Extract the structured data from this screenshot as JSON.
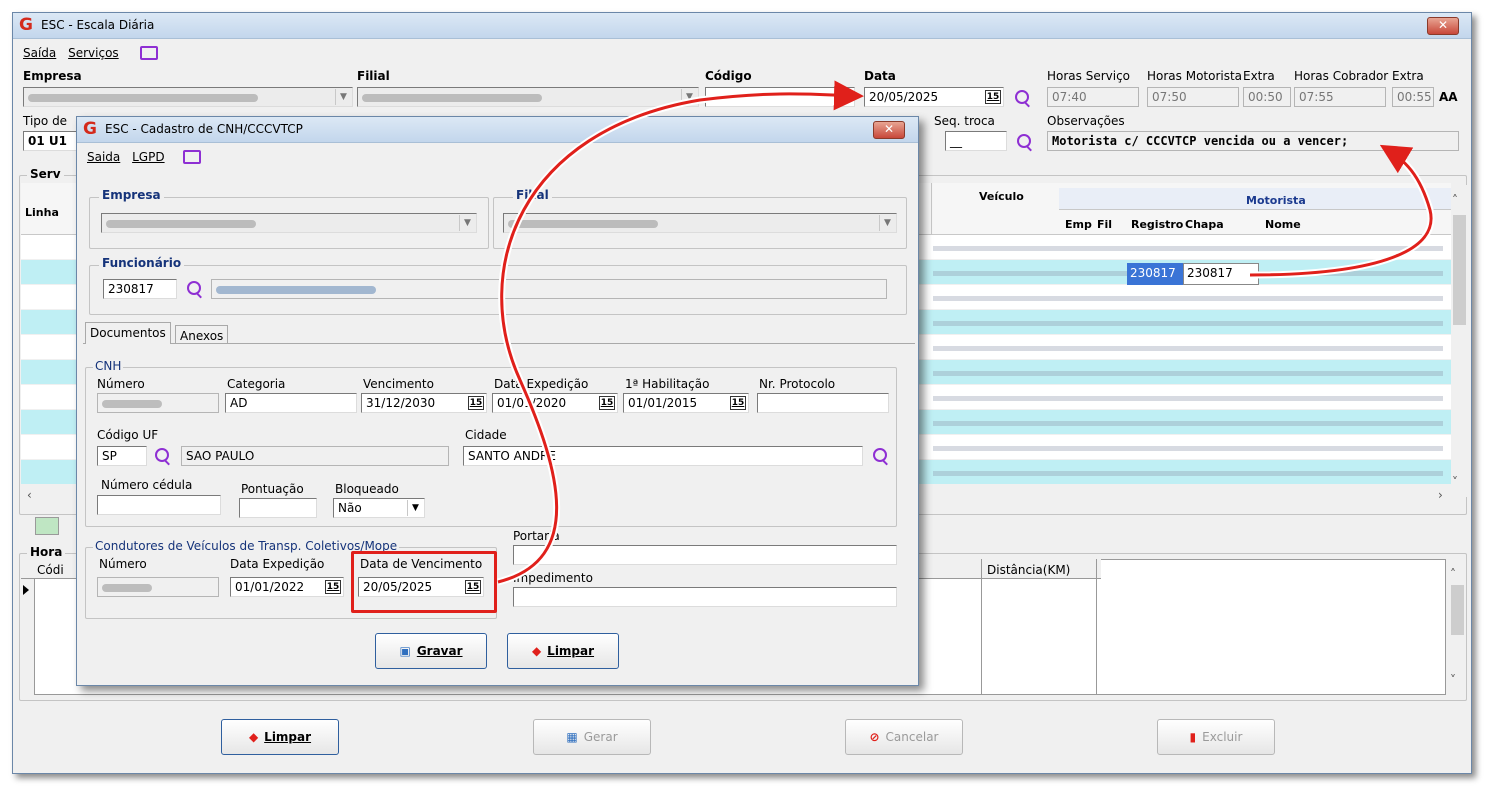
{
  "main": {
    "title": "ESC - Escala Diária",
    "close": "✕",
    "menu": {
      "saida": "Saída",
      "servicos": "Serviços"
    },
    "labels": {
      "empresa": "Empresa",
      "filial": "Filial",
      "codigo": "Código",
      "data": "Data",
      "horas_servico": "Horas Serviço",
      "horas_motorista": "Horas Motorista",
      "extra1": "Extra",
      "horas_cobrador": "Horas Cobrador",
      "extra2": "Extra",
      "tipo": "Tipo de",
      "seq_troca": "Seq. troca",
      "observacoes": "Observações",
      "tipo_value": "01 U1",
      "serv": "Serv",
      "hora": "Hora",
      "linha": "Linha",
      "codi": "Códi",
      "veiculo": "Veículo",
      "motorista": "Motorista",
      "emp": "Emp",
      "fil": "Fil",
      "registro": "Registro",
      "chapa": "Chapa",
      "nome": "Nome",
      "distancia": "Distância(KM)"
    },
    "data_value": "20/05/2025",
    "cal_icon": "15",
    "horas_servico": "07:40",
    "horas_motorista": "07:50",
    "extra1": "00:50",
    "horas_cobrador": "07:55",
    "extra2": "00:55",
    "font_icon": "AA",
    "seq_troca": "__",
    "observacoes": "Motorista c/ CCCVTCP vencida ou a vencer;",
    "selected_registro": "230817",
    "selected_chapa": "230817",
    "buttons": {
      "limpar": "Limpar",
      "gerar": "Gerar",
      "cancelar": "Cancelar",
      "excluir": "Excluir"
    }
  },
  "dialog": {
    "title": "ESC - Cadastro de CNH/CCCVTCP",
    "close": "✕",
    "menu": {
      "saida": "Saida",
      "lgpd": "LGPD"
    },
    "empresa": "Empresa",
    "filial": "Filial",
    "funcionario": "Funcionário",
    "funcionario_value": "230817",
    "tabs": [
      "Documentos",
      "Anexos"
    ],
    "cnh": {
      "group": "CNH",
      "numero": "Número",
      "categoria": "Categoria",
      "categoria_value": "AD",
      "vencimento": "Vencimento",
      "vencimento_value": "31/12/2030",
      "data_expedicao": "Data Expedição",
      "data_expedicao_value": "01/01/2020",
      "primeira_hab": "1ª Habilitação",
      "primeira_hab_value": "01/01/2015",
      "nr_protocolo": "Nr. Protocolo",
      "codigo_uf": "Código UF",
      "uf_value": "SP",
      "uf_nome": "SAO PAULO",
      "cidade": "Cidade",
      "cidade_value": "SANTO ANDRE",
      "numero_cedula": "Número cédula",
      "pontuacao": "Pontuação",
      "bloqueado": "Bloqueado",
      "bloqueado_value": "Não"
    },
    "condutores": {
      "group": "Condutores de Veículos de Transp. Coletivos/Mope",
      "numero": "Número",
      "data_expedicao": "Data Expedição",
      "data_expedicao_value": "01/01/2022",
      "data_vencimento": "Data de Vencimento",
      "data_vencimento_value": "20/05/2025"
    },
    "portaria": "Portaria",
    "impedimento": "Impedimento",
    "buttons": {
      "gravar": "Gravar",
      "limpar": "Limpar"
    }
  },
  "colors": {
    "accent_red": "#e0201b",
    "highlight": "#bfeff4",
    "selection": "#3a74d6"
  }
}
